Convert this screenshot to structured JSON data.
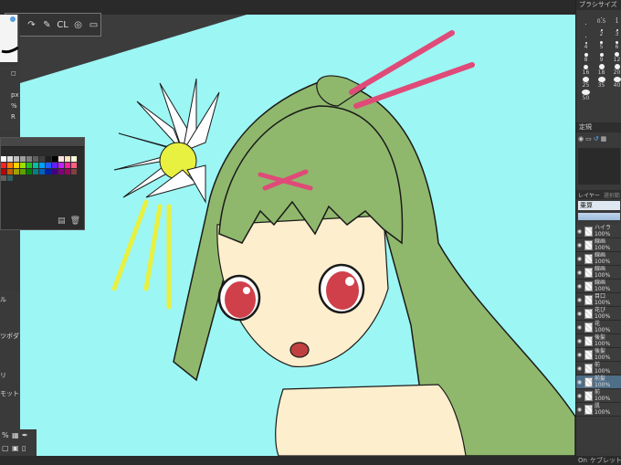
{
  "toolbar": {
    "undo_label": "↶",
    "redo_label": "↷",
    "pen_label": "✎",
    "cl_label": "CL",
    "dot_label": "◎",
    "frame_label": "▭"
  },
  "brush_panel": {
    "title": "ブラシサイズ",
    "sizes": [
      {
        "label": "",
        "d": 1
      },
      {
        "label": "0.5",
        "d": 1
      },
      {
        "label": "1",
        "d": 1
      },
      {
        "label": "",
        "d": 1
      },
      {
        "label": "2",
        "d": 2
      },
      {
        "label": "3",
        "d": 2
      },
      {
        "label": "4",
        "d": 2
      },
      {
        "label": "5",
        "d": 3
      },
      {
        "label": "6",
        "d": 3
      },
      {
        "label": "8",
        "d": 4
      },
      {
        "label": "9",
        "d": 4
      },
      {
        "label": "12",
        "d": 5
      },
      {
        "label": "16",
        "d": 5
      },
      {
        "label": "18",
        "d": 6
      },
      {
        "label": "20",
        "d": 6
      },
      {
        "label": "25",
        "d": 7
      },
      {
        "label": "35",
        "d": 8
      },
      {
        "label": "40",
        "d": 8
      },
      {
        "label": "50",
        "d": 9
      }
    ]
  },
  "stabilizer_panel": {
    "title": "定規"
  },
  "layer_panel": {
    "tab_layer": "レイヤー",
    "tab_nav": "選択範",
    "blend_mode": "乗算",
    "layers": [
      {
        "name": "ハイラ",
        "opacity": "100%"
      },
      {
        "name": "線画",
        "opacity": "100%"
      },
      {
        "name": "線画",
        "opacity": "100%"
      },
      {
        "name": "線画",
        "opacity": "100%"
      },
      {
        "name": "線画",
        "opacity": "100%"
      },
      {
        "name": "目口",
        "opacity": "100%"
      },
      {
        "name": "花び",
        "opacity": "100%"
      },
      {
        "name": "花",
        "opacity": "100%"
      },
      {
        "name": "後髪",
        "opacity": "100%"
      },
      {
        "name": "後髪",
        "opacity": "100%"
      },
      {
        "name": "前",
        "opacity": "100%"
      },
      {
        "name": "前髪",
        "opacity": "100%"
      },
      {
        "name": "前",
        "opacity": "100%"
      },
      {
        "name": "肌",
        "opacity": "100%"
      }
    ]
  },
  "left_panel": {
    "prop_px": "px",
    "prop_pct": "%",
    "prop_r": "R",
    "lower_items": [
      "ル",
      "ツボダ",
      "リ",
      "モット"
    ],
    "zoom_text": "%"
  },
  "status": {
    "left": "On",
    "right": "ケブレット 1"
  },
  "colors": {
    "canvas_bg": "#9cf6f4",
    "hair": "#8fb86c",
    "skin": "#fdeecd",
    "eyes": "#d0404a",
    "hairpin": "#e04a78",
    "flower_center": "#e8f040"
  },
  "palette_colors": [
    "#ffffff",
    "#e0e0e0",
    "#bfbfbf",
    "#9f9f9f",
    "#7f7f7f",
    "#5f5f5f",
    "#3f3f3f",
    "#1f1f1f",
    "#000000",
    "#ffe0e0",
    "#ffe0c0",
    "#ffffe0",
    "#ff2020",
    "#ff8000",
    "#ffd000",
    "#a0e000",
    "#20c020",
    "#00c0a0",
    "#00a0ff",
    "#2060ff",
    "#6020ff",
    "#c020ff",
    "#ff20a0",
    "#ff6080",
    "#c00000",
    "#c06000",
    "#a0a000",
    "#60a000",
    "#008000",
    "#008080",
    "#0060c0",
    "#0020a0",
    "#400080",
    "#800080",
    "#a00060",
    "#804040",
    "#606060",
    "#306060"
  ]
}
